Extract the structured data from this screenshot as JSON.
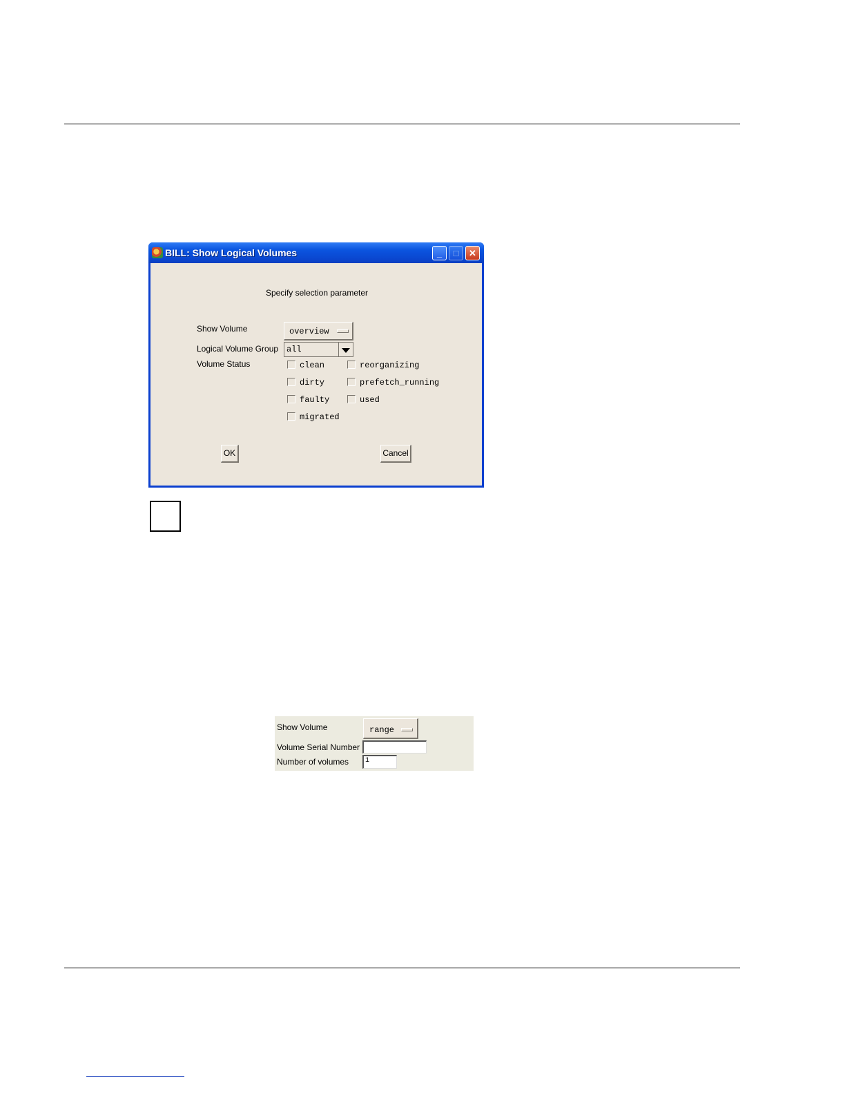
{
  "window": {
    "title": "BILL: Show Logical Volumes",
    "controls": {
      "minimize": "_",
      "maximize": "□",
      "close": "✕"
    }
  },
  "dialog": {
    "heading": "Specify selection parameter",
    "show_volume": {
      "label": "Show Volume",
      "value": "overview"
    },
    "logical_volume_group": {
      "label": "Logical Volume Group",
      "value": "all"
    },
    "volume_status": {
      "label": "Volume Status",
      "options": [
        {
          "label": "clean",
          "checked": false
        },
        {
          "label": "reorganizing",
          "checked": false
        },
        {
          "label": "dirty",
          "checked": false
        },
        {
          "label": "prefetch_running",
          "checked": false
        },
        {
          "label": "faulty",
          "checked": false
        },
        {
          "label": "used",
          "checked": false
        },
        {
          "label": "migrated",
          "checked": false
        }
      ]
    },
    "ok_label": "OK",
    "cancel_label": "Cancel"
  },
  "range_panel": {
    "show_volume": {
      "label": "Show Volume",
      "value": "range"
    },
    "serial_number": {
      "label": "Volume Serial Number",
      "value": ""
    },
    "number_of_volumes": {
      "label": "Number of volumes",
      "value": "1"
    }
  },
  "colors": {
    "titlebar": "#0a46cf",
    "dialog_bg": "#ece6dc",
    "panel_bg": "#ecebe0",
    "close_button": "#c83a1e"
  }
}
